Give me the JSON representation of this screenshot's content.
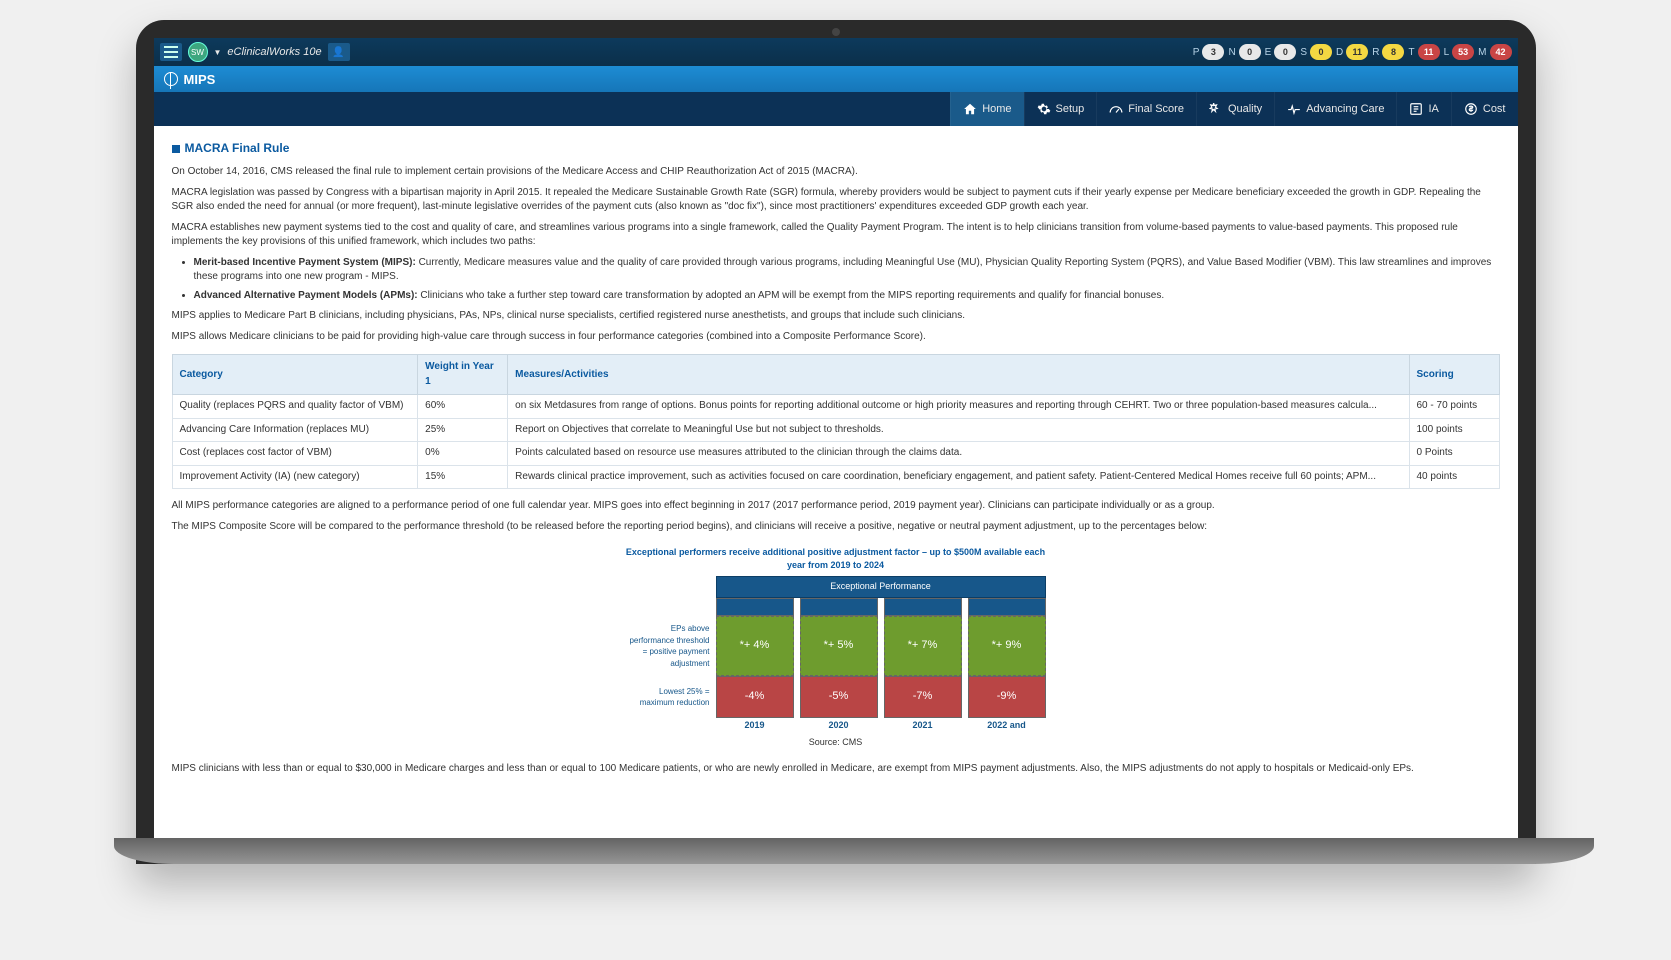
{
  "topbar": {
    "title": "eClinicalWorks 10e",
    "sw": "SW",
    "pills": [
      {
        "letter": "P",
        "value": "3",
        "color": "white"
      },
      {
        "letter": "N",
        "value": "0",
        "color": "white"
      },
      {
        "letter": "E",
        "value": "0",
        "color": "white"
      },
      {
        "letter": "S",
        "value": "0",
        "color": "yellow"
      },
      {
        "letter": "D",
        "value": "11",
        "color": "yellow"
      },
      {
        "letter": "R",
        "value": "8",
        "color": "yellow"
      },
      {
        "letter": "T",
        "value": "11",
        "color": "red"
      },
      {
        "letter": "L",
        "value": "53",
        "color": "red"
      },
      {
        "letter": "M",
        "value": "42",
        "color": "red"
      }
    ]
  },
  "module_title": "MIPS",
  "nav": [
    {
      "label": "Home",
      "active": true
    },
    {
      "label": "Setup",
      "active": false
    },
    {
      "label": "Final Score",
      "active": false
    },
    {
      "label": "Quality",
      "active": false
    },
    {
      "label": "Advancing Care",
      "active": false
    },
    {
      "label": "IA",
      "active": false
    },
    {
      "label": "Cost",
      "active": false
    }
  ],
  "section_title": "MACRA Final Rule",
  "paragraphs": {
    "p1": "On October 14, 2016, CMS released the final rule to implement certain provisions of the Medicare Access and CHIP Reauthorization Act of 2015 (MACRA).",
    "p2": "MACRA legislation was passed by Congress with a bipartisan majority in April 2015. It repealed the Medicare Sustainable Growth Rate (SGR) formula, whereby providers would be subject to payment cuts if their yearly expense per Medicare beneficiary exceeded the growth in GDP. Repealing the SGR also ended the need for annual (or more frequent), last-minute legislative overrides of the payment cuts (also known as \"doc fix\"), since most practitioners' expenditures exceeded GDP growth each year.",
    "p3": "MACRA establishes new payment systems tied to the cost and quality of care, and streamlines various programs into a single framework, called the Quality Payment Program. The intent is to help clinicians transition from volume-based payments to value-based payments. This proposed rule implements the key provisions of this unified framework, which includes two paths:",
    "li1_bold": "Merit-based Incentive Payment System (MIPS):",
    "li1_text": " Currently, Medicare measures value and the quality of care provided through various programs, including Meaningful Use (MU), Physician Quality Reporting System (PQRS), and Value Based Modifier (VBM). This law streamlines and improves these programs into one new program - MIPS.",
    "li2_bold": "Advanced Alternative Payment Models (APMs):",
    "li2_text": " Clinicians who take a further step toward care transformation by adopted an APM will be exempt from the MIPS reporting requirements and qualify for financial bonuses.",
    "p4": "MIPS applies to Medicare Part B clinicians, including physicians, PAs, NPs, clinical nurse specialists, certified registered nurse anesthetists, and groups that include such clinicians.",
    "p5": "MIPS allows Medicare clinicians to be paid for providing high-value care through success in four performance categories (combined into a Composite Performance Score).",
    "p6": "All MIPS performance categories are aligned to a performance period of one full calendar year. MIPS goes into effect beginning in 2017 (2017 performance period, 2019 payment year). Clinicians can participate individually or as a group.",
    "p7": "The MIPS Composite Score will be compared to the performance threshold (to be released before the reporting period begins), and clinicians will receive a positive, negative or neutral payment adjustment, up to the percentages below:",
    "p8": "MIPS clinicians with less than or equal to $30,000 in Medicare charges and less than or equal to 100 Medicare patients, or who are newly enrolled in Medicare, are exempt from MIPS payment adjustments. Also, the MIPS adjustments do not apply to hospitals or Medicaid-only EPs."
  },
  "table": {
    "headers": {
      "c1": "Category",
      "c2": "Weight in Year 1",
      "c3": "Measures/Activities",
      "c4": "Scoring"
    },
    "rows": [
      {
        "c1": "Quality (replaces PQRS and quality factor of VBM)",
        "c2": "60%",
        "c3": "on six Metdasures from range of options. Bonus points for reporting additional outcome or high priority measures and reporting through CEHRT. Two or three population-based measures calcula...",
        "c4": "60 - 70 points"
      },
      {
        "c1": "Advancing Care Information (replaces MU)",
        "c2": "25%",
        "c3": "Report on Objectives that correlate to Meaningful Use but not subject to thresholds.",
        "c4": "100 points"
      },
      {
        "c1": "Cost (replaces cost factor of VBM)",
        "c2": "0%",
        "c3": "Points calculated based on resource use measures attributed to the clinician through the claims data.",
        "c4": "0 Points"
      },
      {
        "c1": "Improvement Activity (IA) (new category)",
        "c2": "15%",
        "c3": "Rewards clinical practice improvement, such as activities focused on care coordination, beneficiary engagement, and patient safety. Patient-Centered Medical Homes receive full 60 points; APM...",
        "c4": "40 points"
      }
    ]
  },
  "chart_data": {
    "type": "table",
    "title": "Exceptional performers receive additional positive adjustment factor – up to $500M available each year from 2019 to 2024",
    "header": "Exceptional Performance",
    "row_labels": {
      "pos": "EPs above performance threshold = positive payment adjustment",
      "neg": "Lowest 25% = maximum reduction"
    },
    "years": [
      "2019",
      "2020",
      "2021",
      "2022 and"
    ],
    "positive": [
      "*+ 4%",
      "*+ 5%",
      "*+ 7%",
      "*+ 9%"
    ],
    "negative": [
      "-4%",
      "-5%",
      "-7%",
      "-9%"
    ],
    "source": "Source: CMS"
  }
}
